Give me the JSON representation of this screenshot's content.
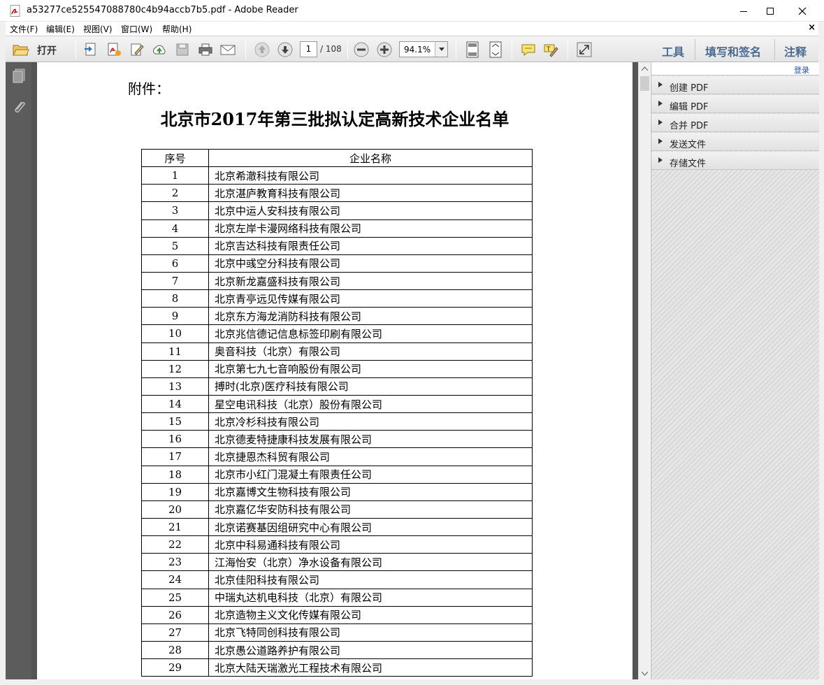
{
  "window": {
    "title": "a53277ce525547088780c4b94accb7b5.pdf - Adobe Reader"
  },
  "menu": {
    "file": "文件(F)",
    "edit": "编辑(E)",
    "view": "视图(V)",
    "window": "窗口(W)",
    "help": "帮助(H)",
    "close_doc": "×"
  },
  "toolbar": {
    "open_label": "打开",
    "page_current": "1",
    "page_total": "/ 108",
    "zoom": "94.1%",
    "tools_label": "工具",
    "fill_sign_label": "填写和签名",
    "comment_label": "注释"
  },
  "right_panel": {
    "login": "登录",
    "tasks": [
      "创建 PDF",
      "编辑 PDF",
      "合并 PDF",
      "发送文件",
      "存储文件"
    ]
  },
  "document": {
    "attachment_label": "附件：",
    "title": "北京市2017年第三批拟认定高新技术企业名单",
    "table": {
      "headers": [
        "序号",
        "企业名称"
      ],
      "rows": [
        [
          "1",
          "北京希澈科技有限公司"
        ],
        [
          "2",
          "北京湛庐教育科技有限公司"
        ],
        [
          "3",
          "北京中运人安科技有限公司"
        ],
        [
          "4",
          "北京左岸卡漫网络科技有限公司"
        ],
        [
          "5",
          "北京吉达科技有限责任公司"
        ],
        [
          "6",
          "北京中彧空分科技有限公司"
        ],
        [
          "7",
          "北京新龙嘉盛科技有限公司"
        ],
        [
          "8",
          "北京青亭远见传媒有限公司"
        ],
        [
          "9",
          "北京东方海龙消防科技有限公司"
        ],
        [
          "10",
          "北京兆信德记信息标签印刷有限公司"
        ],
        [
          "11",
          "奥音科技（北京）有限公司"
        ],
        [
          "12",
          "北京第七九七音响股份有限公司"
        ],
        [
          "13",
          "搏时(北京)医疗科技有限公司"
        ],
        [
          "14",
          "星空电讯科技（北京）股份有限公司"
        ],
        [
          "15",
          "北京冷杉科技有限公司"
        ],
        [
          "16",
          "北京德麦特捷康科技发展有限公司"
        ],
        [
          "17",
          "北京捷恩杰科贸有限公司"
        ],
        [
          "18",
          "北京市小红门混凝土有限责任公司"
        ],
        [
          "19",
          "北京嘉博文生物科技有限公司"
        ],
        [
          "20",
          "北京嘉亿华安防科技有限公司"
        ],
        [
          "21",
          "北京诺赛基因组研究中心有限公司"
        ],
        [
          "22",
          "北京中科易通科技有限公司"
        ],
        [
          "23",
          "江海怡安（北京）净水设备有限公司"
        ],
        [
          "24",
          "北京佳阳科技有限公司"
        ],
        [
          "25",
          "中瑞丸达机电科技（北京）有限公司"
        ],
        [
          "26",
          "北京造物主义文化传媒有限公司"
        ],
        [
          "27",
          "北京飞特同创科技有限公司"
        ],
        [
          "28",
          "北京愚公道路养护有限公司"
        ],
        [
          "29",
          "北京大陆天瑞激光工程技术有限公司"
        ]
      ]
    }
  }
}
